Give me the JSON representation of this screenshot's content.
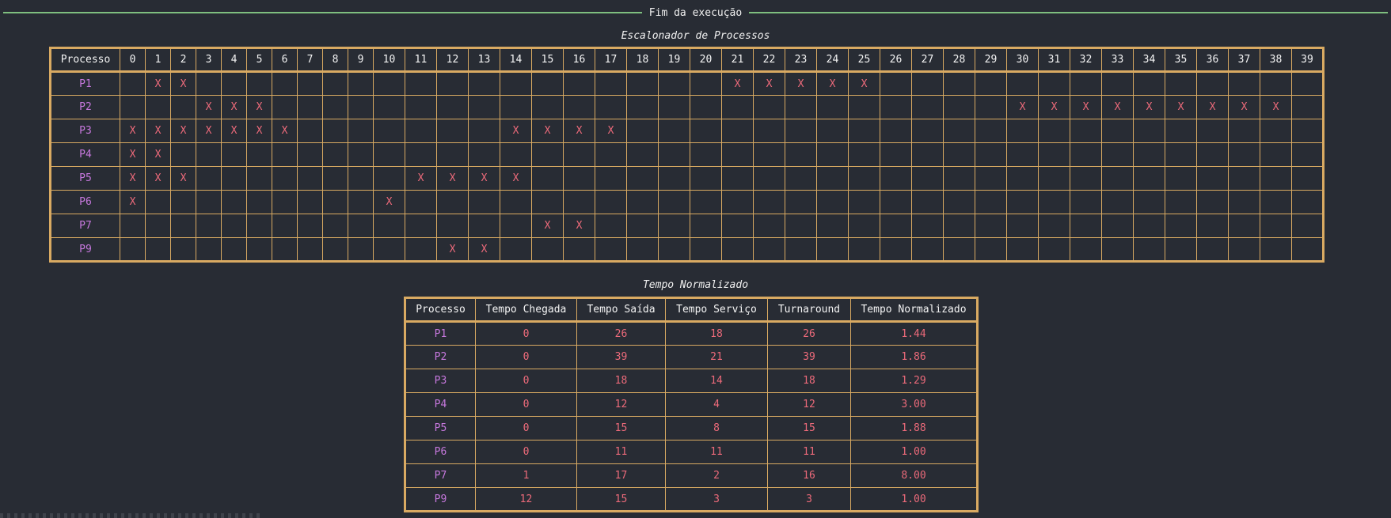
{
  "banner": {
    "title": "Fim da execução"
  },
  "scheduler": {
    "caption": "Escalonador de Processos",
    "header_label": "Processo",
    "time_slots": [
      "0",
      "1",
      "2",
      "3",
      "4",
      "5",
      "6",
      "7",
      "8",
      "9",
      "10",
      "11",
      "12",
      "13",
      "14",
      "15",
      "16",
      "17",
      "18",
      "19",
      "20",
      "21",
      "22",
      "23",
      "24",
      "25",
      "26",
      "27",
      "28",
      "29",
      "30",
      "31",
      "32",
      "33",
      "34",
      "35",
      "36",
      "37",
      "38",
      "39"
    ],
    "mark_symbol": "X",
    "rows": [
      {
        "process": "P1",
        "running_at": [
          1,
          2,
          21,
          22,
          23,
          24,
          25
        ]
      },
      {
        "process": "P2",
        "running_at": [
          3,
          4,
          5,
          30,
          31,
          32,
          33,
          34,
          35,
          36,
          37,
          38
        ]
      },
      {
        "process": "P3",
        "running_at": [
          0,
          1,
          2,
          3,
          4,
          5,
          6,
          14,
          15,
          16,
          17
        ]
      },
      {
        "process": "P4",
        "running_at": [
          0,
          1
        ]
      },
      {
        "process": "P5",
        "running_at": [
          0,
          1,
          2,
          11,
          12,
          13,
          14
        ]
      },
      {
        "process": "P6",
        "running_at": [
          0,
          10
        ]
      },
      {
        "process": "P7",
        "running_at": [
          15,
          16
        ]
      },
      {
        "process": "P9",
        "running_at": [
          12,
          13
        ]
      }
    ]
  },
  "normalized": {
    "caption": "Tempo Normalizado",
    "columns": [
      "Processo",
      "Tempo Chegada",
      "Tempo Saída",
      "Tempo Serviço",
      "Turnaround",
      "Tempo Normalizado"
    ],
    "rows": [
      [
        "P1",
        "0",
        "26",
        "18",
        "26",
        "1.44"
      ],
      [
        "P2",
        "0",
        "39",
        "21",
        "39",
        "1.86"
      ],
      [
        "P3",
        "0",
        "18",
        "14",
        "18",
        "1.29"
      ],
      [
        "P4",
        "0",
        "12",
        "4",
        "12",
        "3.00"
      ],
      [
        "P5",
        "0",
        "15",
        "8",
        "15",
        "1.88"
      ],
      [
        "P6",
        "0",
        "11",
        "11",
        "11",
        "1.00"
      ],
      [
        "P7",
        "1",
        "17",
        "2",
        "16",
        "8.00"
      ],
      [
        "P9",
        "12",
        "15",
        "3",
        "3",
        "1.00"
      ]
    ]
  },
  "colors": {
    "background": "#282c34",
    "border": "#d9aa62",
    "process": "#c678dd",
    "value": "#ec6a7a",
    "rule": "#7fbf7f"
  }
}
